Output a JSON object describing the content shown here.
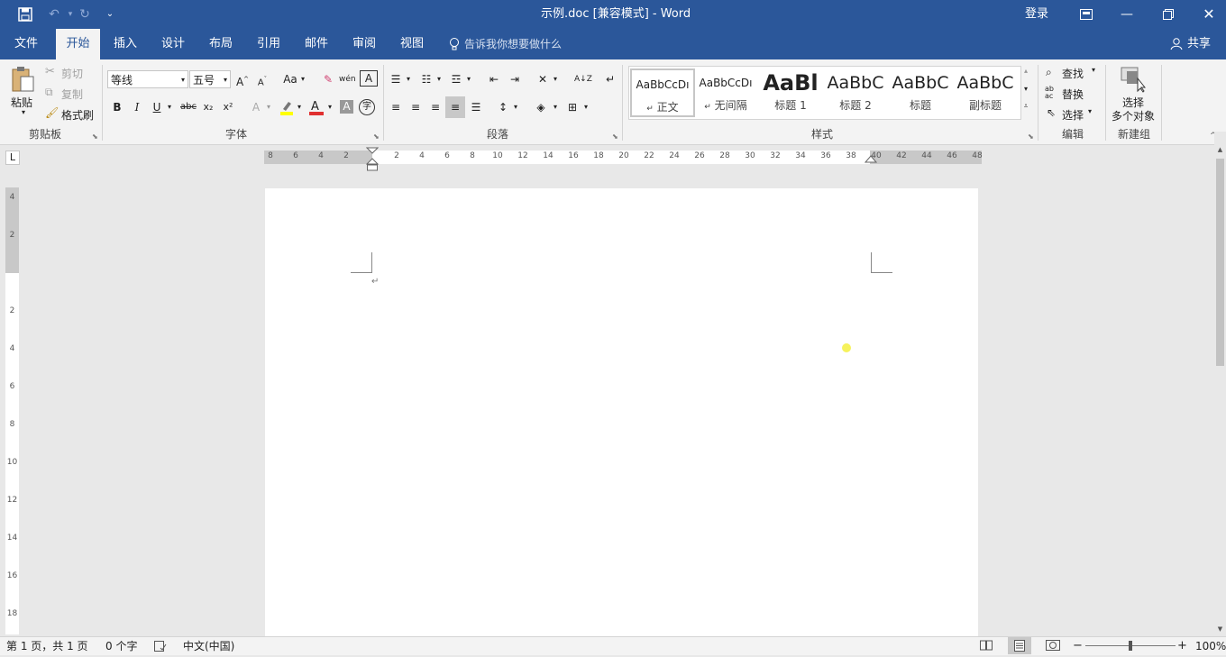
{
  "title_bar": {
    "title": "示例.doc [兼容模式]  -  Word",
    "login": "登录"
  },
  "tabs": [
    "文件",
    "开始",
    "插入",
    "设计",
    "布局",
    "引用",
    "邮件",
    "审阅",
    "视图"
  ],
  "tell_me": "告诉我你想要做什么",
  "share": "共享",
  "clipboard": {
    "paste": "粘贴",
    "cut": "剪切",
    "copy": "复制",
    "format_painter": "格式刷",
    "group_label": "剪贴板"
  },
  "font": {
    "font_name": "等线",
    "font_size": "五号",
    "change_case": "Aa",
    "group_label": "字体"
  },
  "paragraph": {
    "group_label": "段落"
  },
  "styles": {
    "items": [
      {
        "preview": "AaBbCcDı",
        "name": "正文",
        "prefix": "↵"
      },
      {
        "preview": "AaBbCcDı",
        "name": "无间隔",
        "prefix": "↵"
      },
      {
        "preview": "AaBl",
        "name": "标题 1",
        "prefix": ""
      },
      {
        "preview": "AaBbC",
        "name": "标题 2",
        "prefix": ""
      },
      {
        "preview": "AaBbC",
        "name": "标题",
        "prefix": ""
      },
      {
        "preview": "AaBbC",
        "name": "副标题",
        "prefix": ""
      }
    ],
    "group_label": "样式"
  },
  "editing": {
    "find": "查找",
    "replace": "替换",
    "select": "选择",
    "group_label": "编辑"
  },
  "new_group": {
    "select_line1": "选择",
    "select_line2": "多个对象",
    "group_label": "新建组"
  },
  "ruler": {
    "left_labels": [
      "8",
      "6",
      "4",
      "2"
    ],
    "right_labels": [
      "2",
      "4",
      "6",
      "8",
      "10",
      "12",
      "14",
      "16",
      "18",
      "20",
      "22",
      "24",
      "26",
      "28",
      "30",
      "32",
      "34",
      "36",
      "38",
      "40",
      "42",
      "44",
      "46",
      "48"
    ],
    "vertical_top": [
      "4",
      "2"
    ],
    "vertical_labels": [
      "2",
      "4",
      "6",
      "8",
      "10",
      "12",
      "14",
      "16",
      "18"
    ],
    "tab_selector": "L"
  },
  "status_bar": {
    "page_info": "第 1 页，共 1 页",
    "word_count": "0 个字",
    "language": "中文(中国)",
    "zoom": "100%"
  },
  "colors": {
    "brand": "#2b579a",
    "font_color": "#e03030",
    "highlight": "#ffff00"
  }
}
